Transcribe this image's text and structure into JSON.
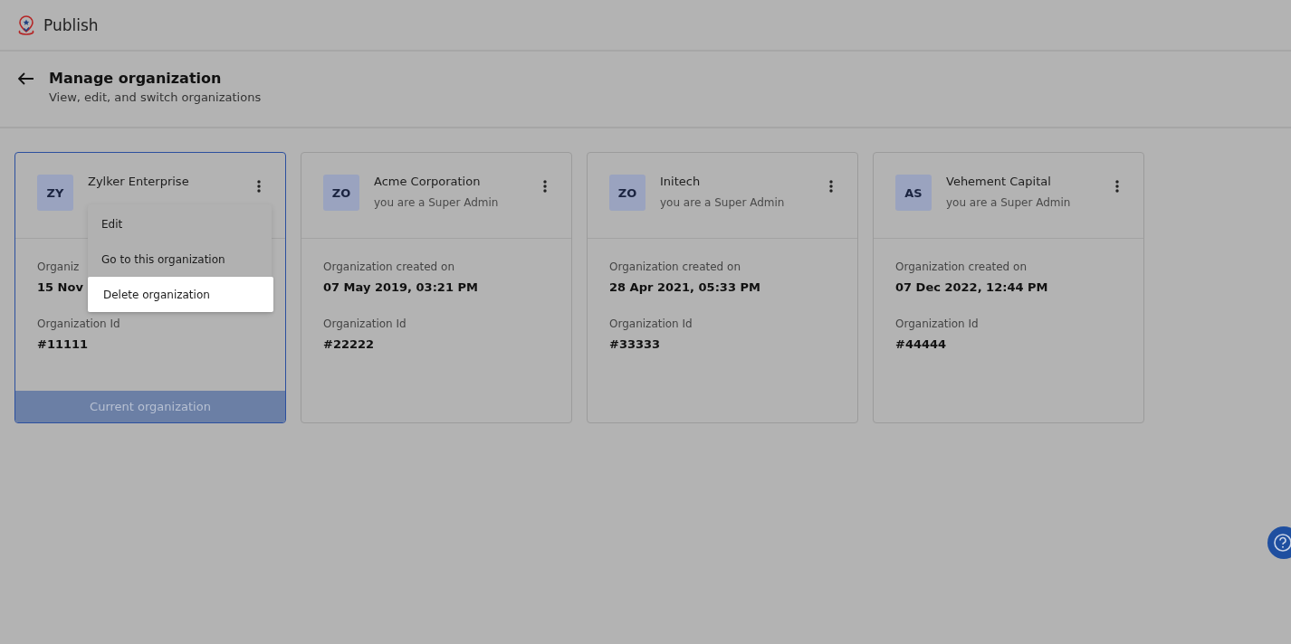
{
  "app": {
    "title": "Publish"
  },
  "page": {
    "title": "Manage organization",
    "subtitle": "View, edit, and switch organizations"
  },
  "organizations": [
    {
      "initials": "ZY",
      "name": "Zylker Enterprise",
      "created_label": "Organiz",
      "created": "15 Nov",
      "id_label": "Organization Id",
      "id": "#11111",
      "current": true,
      "footer": "Current organization",
      "menu": [
        {
          "label": "Edit",
          "selected": false
        },
        {
          "label": "Go to this organization",
          "selected": false
        },
        {
          "label": "Delete organization",
          "selected": true
        }
      ]
    },
    {
      "initials": "ZO",
      "name": "Acme Corporation",
      "role": "you are a Super Admin",
      "created_label": "Organization created on",
      "created": "07 May 2019, 03:21 PM",
      "id_label": "Organization Id",
      "id": "#22222",
      "current": false
    },
    {
      "initials": "ZO",
      "name": "Initech",
      "role": "you are a Super Admin",
      "created_label": "Organization created on",
      "created": "28 Apr 2021, 05:33 PM",
      "id_label": "Organization Id",
      "id": "#33333",
      "current": false
    },
    {
      "initials": "AS",
      "name": "Vehement Capital",
      "role": "you are a Super Admin",
      "created_label": "Organization created on",
      "created": "07 Dec 2022, 12:44 PM",
      "id_label": "Organization Id",
      "id": "#44444",
      "current": false
    }
  ]
}
